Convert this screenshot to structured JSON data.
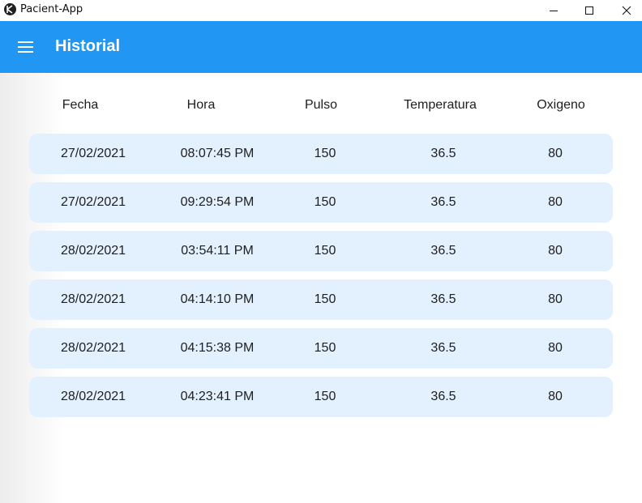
{
  "window": {
    "title": "Pacient-App"
  },
  "appbar": {
    "menu_icon": "menu-icon",
    "title": "Historial",
    "color": "#2196f3"
  },
  "table": {
    "headers": [
      "Fecha",
      "Hora",
      "Pulso",
      "Temperatura",
      "Oxigeno"
    ],
    "rows": [
      [
        "27/02/2021",
        "08:07:45 PM",
        "150",
        "36.5",
        "80"
      ],
      [
        "27/02/2021",
        "09:29:54 PM",
        "150",
        "36.5",
        "80"
      ],
      [
        "28/02/2021",
        "03:54:11 PM",
        "150",
        "36.5",
        "80"
      ],
      [
        "28/02/2021",
        "04:14:10 PM",
        "150",
        "36.5",
        "80"
      ],
      [
        "28/02/2021",
        "04:15:38 PM",
        "150",
        "36.5",
        "80"
      ],
      [
        "28/02/2021",
        "04:23:41 PM",
        "150",
        "36.5",
        "80"
      ]
    ],
    "row_color": "#e3f0fd"
  }
}
